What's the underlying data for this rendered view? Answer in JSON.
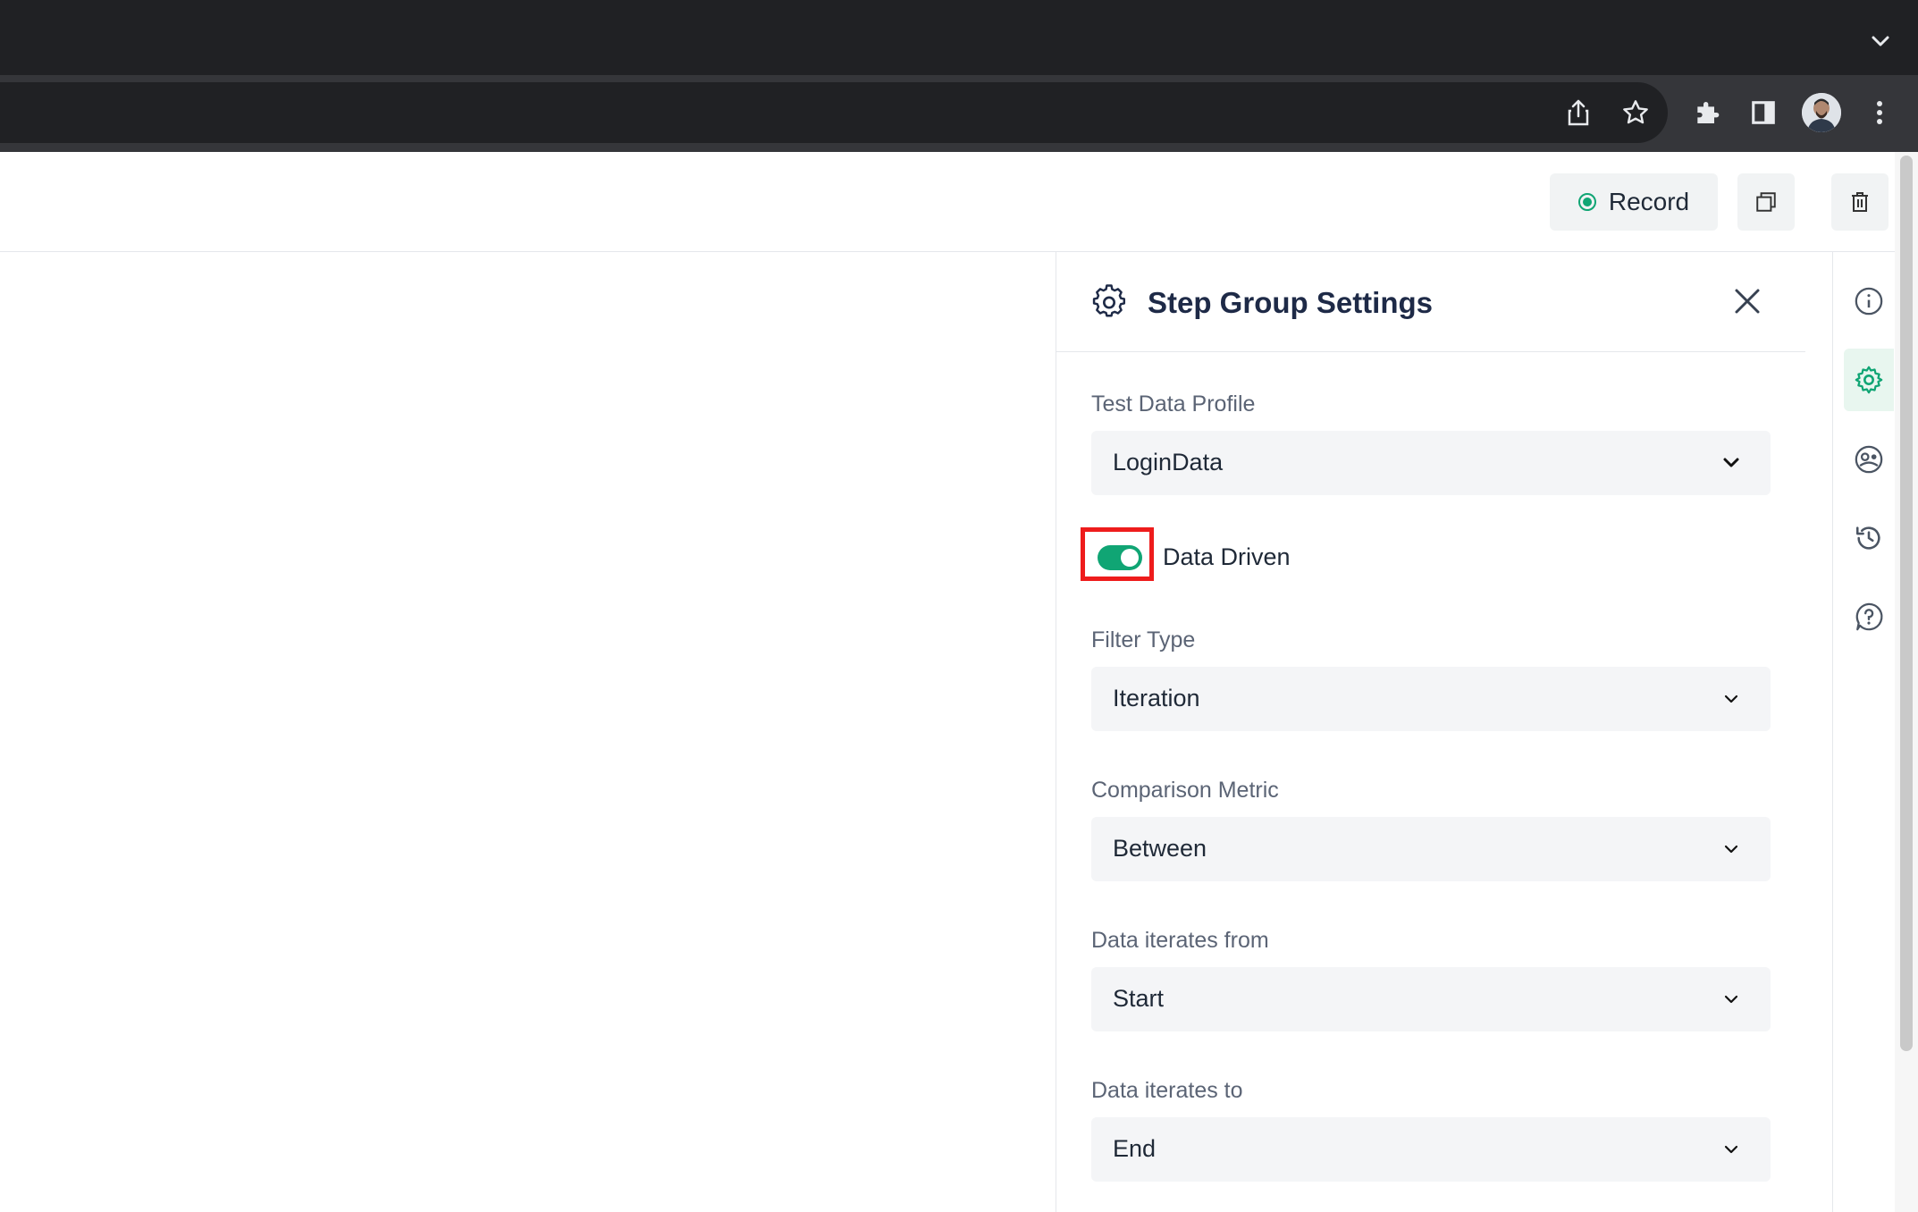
{
  "header": {
    "record_label": "Record"
  },
  "panel": {
    "title": "Step Group Settings",
    "test_data_profile": {
      "label": "Test Data Profile",
      "value": "LoginData"
    },
    "data_driven": {
      "label": "Data Driven",
      "enabled": true
    },
    "filter_type": {
      "label": "Filter Type",
      "value": "Iteration"
    },
    "comparison_metric": {
      "label": "Comparison Metric",
      "value": "Between"
    },
    "iterates_from": {
      "label": "Data iterates from",
      "value": "Start"
    },
    "iterates_to": {
      "label": "Data iterates to",
      "value": "End"
    }
  },
  "rail": {
    "items": [
      "info-icon",
      "settings-icon",
      "test-data-icon",
      "history-icon",
      "help-icon"
    ],
    "active": "settings-icon"
  },
  "colors": {
    "accent": "#10a574",
    "highlight": "#ee1c1c",
    "title": "#1e2a47"
  }
}
